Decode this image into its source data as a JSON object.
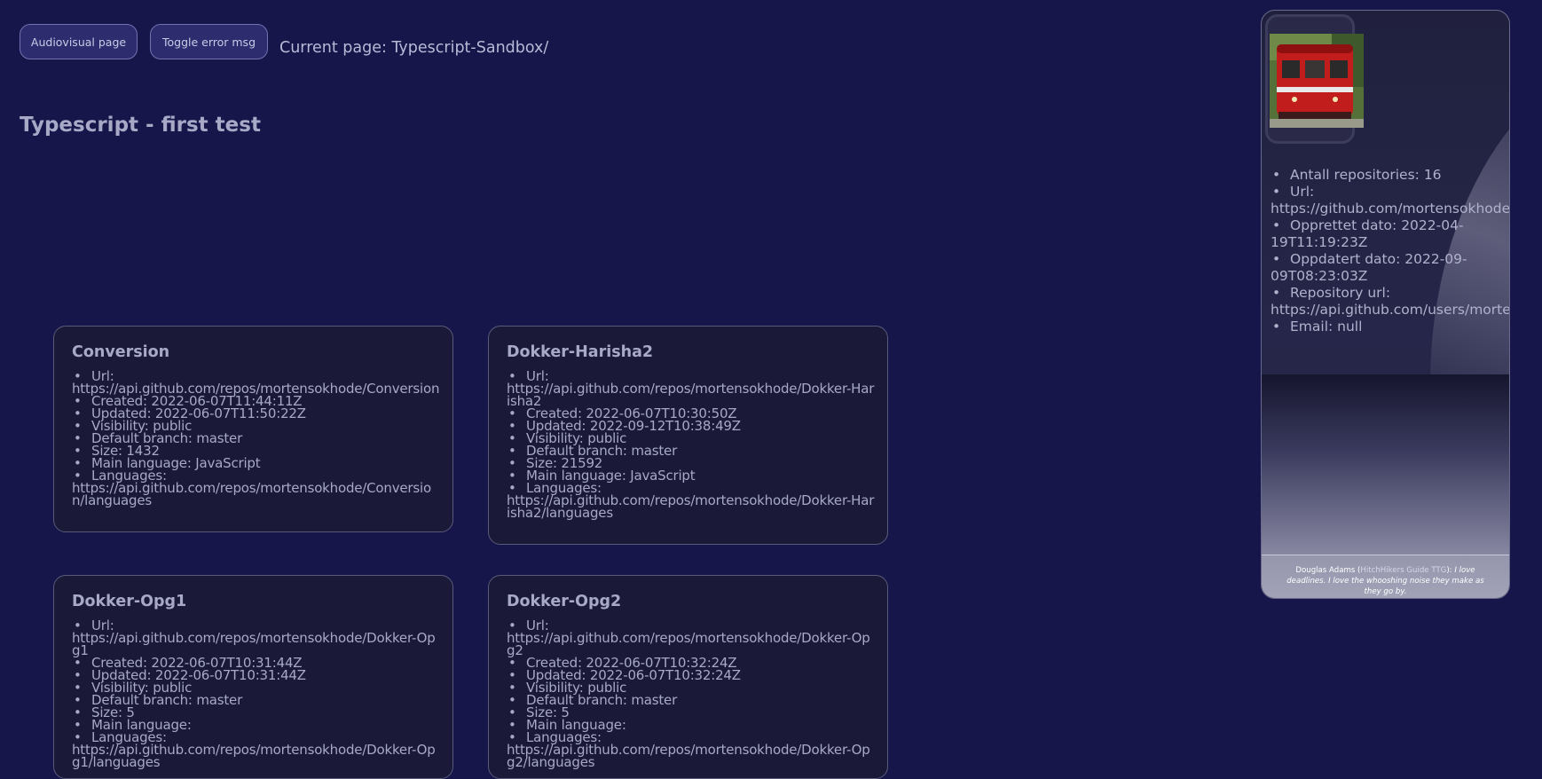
{
  "header": {
    "audiovisual_button": "Audiovisual page",
    "toggle_error_button": "Toggle error msg",
    "current_page": "Current page: Typescript-Sandbox/"
  },
  "page_title": "Typescript - first test",
  "repos": [
    {
      "name": "Conversion",
      "url_label": "Url:",
      "url": "https://api.github.com/repos/mortensokhode/Conversion",
      "created": "Created: 2022-06-07T11:44:11Z",
      "updated": "Updated: 2022-06-07T11:50:22Z",
      "visibility": "Visibility: public",
      "branch": "Default branch: master",
      "size": "Size: 1432",
      "language": "Main language: JavaScript",
      "languages_label": "Languages:",
      "languages_url": "https://api.github.com/repos/mortensokhode/Conversion/languages"
    },
    {
      "name": "Dokker-Harisha2",
      "url_label": "Url:",
      "url": "https://api.github.com/repos/mortensokhode/Dokker-Harisha2",
      "created": "Created: 2022-06-07T10:30:50Z",
      "updated": "Updated: 2022-09-12T10:38:49Z",
      "visibility": "Visibility: public",
      "branch": "Default branch: master",
      "size": "Size: 21592",
      "language": "Main language: JavaScript",
      "languages_label": "Languages:",
      "languages_url": "https://api.github.com/repos/mortensokhode/Dokker-Harisha2/languages"
    },
    {
      "name": "Dokker-Opg1",
      "url_label": "Url:",
      "url": "https://api.github.com/repos/mortensokhode/Dokker-Opg1",
      "created": "Created: 2022-06-07T10:31:44Z",
      "updated": "Updated: 2022-06-07T10:31:44Z",
      "visibility": "Visibility: public",
      "branch": "Default branch: master",
      "size": "Size: 5",
      "language": "Main language:",
      "languages_label": "Languages:",
      "languages_url": "https://api.github.com/repos/mortensokhode/Dokker-Opg1/languages"
    },
    {
      "name": "Dokker-Opg2",
      "url_label": "Url:",
      "url": "https://api.github.com/repos/mortensokhode/Dokker-Opg2",
      "created": "Created: 2022-06-07T10:32:24Z",
      "updated": "Updated: 2022-06-07T10:32:24Z",
      "visibility": "Visibility: public",
      "branch": "Default branch: master",
      "size": "Size: 5",
      "language": "Main language:",
      "languages_label": "Languages:",
      "languages_url": "https://api.github.com/repos/mortensokhode/Dokker-Opg2/languages"
    }
  ],
  "profile": {
    "repo_count": "Antall repositories: 16",
    "url_label": "Url:",
    "url": "https://github.com/mortensokhode",
    "created_a": "Opprettet dato: 2022-04-",
    "created_b": "19T11:19:23Z",
    "updated_a": "Oppdatert dato: 2022-09-",
    "updated_b": "09T08:23:03Z",
    "repo_url_label": "Repository url:",
    "repo_url": "https://api.github.com/users/mortensokhode/repos",
    "email": "Email: null",
    "avatar_icon": "red-tram-photo"
  },
  "quote": {
    "author": "Douglas Adams",
    "source": "HitchHikers Guide TTG",
    "text": "I love deadlines. I love the whooshing noise they make as they go by."
  },
  "colors": {
    "background": "#16164a",
    "card_background": "#1a1a38",
    "button_background": "#2c2c6e",
    "text": "#a7a9c6"
  }
}
